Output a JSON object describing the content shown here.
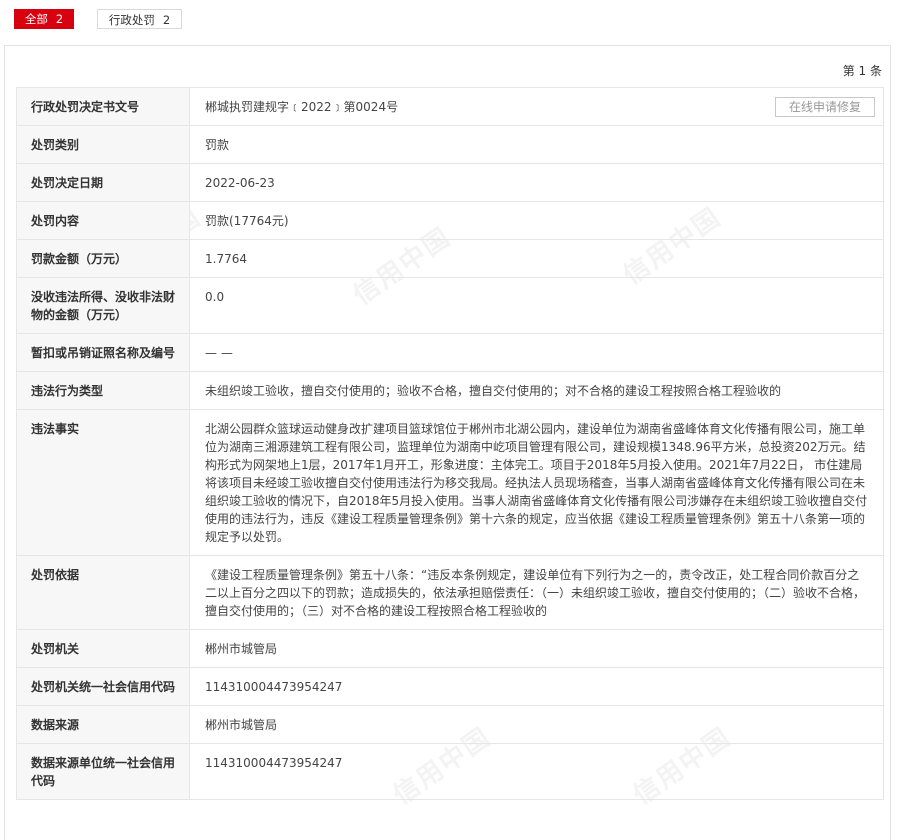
{
  "tabs": [
    {
      "label": "全部",
      "count": "2"
    },
    {
      "label": "行政处罚",
      "count": "2"
    }
  ],
  "record_count": "第 1 条",
  "repair_button": "在线申请修复",
  "watermark": "信用中国",
  "rows": [
    {
      "label": "行政处罚决定书文号",
      "value": "郴城执罚建规字﹝2022﹞第0024号"
    },
    {
      "label": "处罚类别",
      "value": "罚款"
    },
    {
      "label": "处罚决定日期",
      "value": "2022-06-23"
    },
    {
      "label": "处罚内容",
      "value": "罚款(17764元)"
    },
    {
      "label": "罚款金额（万元）",
      "value": "1.7764"
    },
    {
      "label": "没收违法所得、没收非法财物的金额（万元）",
      "value": "0.0"
    },
    {
      "label": "暂扣或吊销证照名称及编号",
      "value": "— —"
    },
    {
      "label": "违法行为类型",
      "value": "未组织竣工验收，擅自交付使用的；验收不合格，擅自交付使用的；对不合格的建设工程按照合格工程验收的"
    },
    {
      "label": "违法事实",
      "value": "北湖公园群众篮球运动健身改扩建项目篮球馆位于郴州市北湖公园内，建设单位为湖南省盛峰体育文化传播有限公司，施工单位为湖南三湘源建筑工程有限公司，监理单位为湖南中屹项目管理有限公司，建设规模1348.96平方米，总投资202万元。结构形式为网架地上1层，2017年1月开工，形象进度：主体完工。项目于2018年5月投入使用。2021年7月22日， 市住建局将该项目未经竣工验收擅自交付使用违法行为移交我局。经执法人员现场稽查，当事人湖南省盛峰体育文化传播有限公司在未组织竣工验收的情况下，自2018年5月投入使用。当事人湖南省盛峰体育文化传播有限公司涉嫌存在未组织竣工验收擅自交付使用的违法行为，违反《建设工程质量管理条例》第十六条的规定，应当依据《建设工程质量管理条例》第五十八条第一项的规定予以处罚。"
    },
    {
      "label": "处罚依据",
      "value": "《建设工程质量管理条例》第五十八条：“违反本条例规定，建设单位有下列行为之一的，责令改正，处工程合同价款百分之二以上百分之四以下的罚款；造成损失的，依法承担赔偿责任：（一）未组织竣工验收，擅自交付使用的；（二）验收不合格，擅自交付使用的；（三）对不合格的建设工程按照合格工程验收的"
    },
    {
      "label": "处罚机关",
      "value": "郴州市城管局"
    },
    {
      "label": "处罚机关统一社会信用代码",
      "value": "11431000447395424​7"
    },
    {
      "label": "数据来源",
      "value": "郴州市城管局"
    },
    {
      "label": "数据来源单位统一社会信用代码",
      "value": "114310004473954247"
    }
  ]
}
